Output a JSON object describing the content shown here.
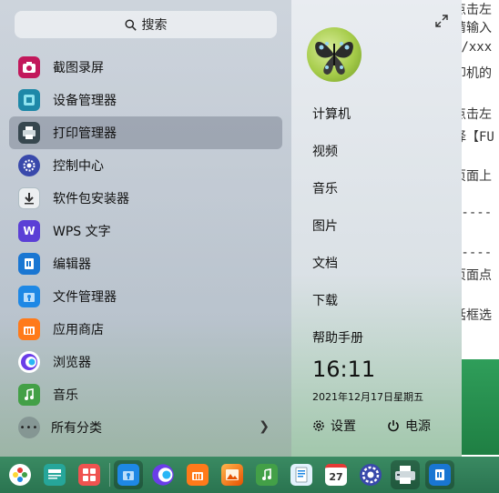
{
  "background_doc": {
    "lines": [
      "点击左",
      "请输入",
      "//xxx",
      "印机的",
      "点击左",
      "择【FU",
      "页面上",
      "-----",
      "-----",
      "页面点",
      "话框选"
    ]
  },
  "search": {
    "label": "搜索",
    "icon": "search-icon"
  },
  "apps": [
    {
      "label": "截图录屏",
      "icon": "screenshot-icon",
      "color": "#c2185b"
    },
    {
      "label": "设备管理器",
      "icon": "device-manager-icon",
      "color": "#1e88a8"
    },
    {
      "label": "打印管理器",
      "icon": "printer-icon",
      "color": "#37474f"
    },
    {
      "label": "控制中心",
      "icon": "gear-icon",
      "color": "#3949ab"
    },
    {
      "label": "软件包安装器",
      "icon": "package-installer-icon",
      "color": "#eceff1"
    },
    {
      "label": "WPS 文字",
      "icon": "wps-writer-icon",
      "color": "#5b3fd6"
    },
    {
      "label": "编辑器",
      "icon": "editor-icon",
      "color": "#1976d2"
    },
    {
      "label": "文件管理器",
      "icon": "file-manager-icon",
      "color": "#1e88e5"
    },
    {
      "label": "应用商店",
      "icon": "app-store-icon",
      "color": "#ff7a1a"
    },
    {
      "label": "浏览器",
      "icon": "browser-icon",
      "color": "#6a3de8"
    },
    {
      "label": "音乐",
      "icon": "music-icon",
      "color": "#43a047"
    }
  ],
  "all_categories": {
    "label": "所有分类",
    "icon": "more-dots-icon",
    "chevron": "chevron-right-icon"
  },
  "side_links": [
    "计算机",
    "视频",
    "音乐",
    "图片",
    "文档",
    "下载",
    "帮助手册"
  ],
  "clock": {
    "time": "16:11",
    "date": "2021年12月17日星期五"
  },
  "system": {
    "settings_label": "设置",
    "power_label": "电源"
  },
  "taskbar": {
    "icons": [
      "launcher-icon",
      "multitask-view-icon",
      "app-grid-icon",
      "file-manager-icon",
      "browser-icon",
      "app-store-icon",
      "image-viewer-icon",
      "music-icon",
      "document-viewer-icon",
      "calendar-icon",
      "control-center-icon",
      "printer-icon",
      "editor-icon"
    ],
    "calendar_day": "27"
  },
  "colors": {
    "accent": "#2a7450",
    "active_item": "#6e7887"
  }
}
